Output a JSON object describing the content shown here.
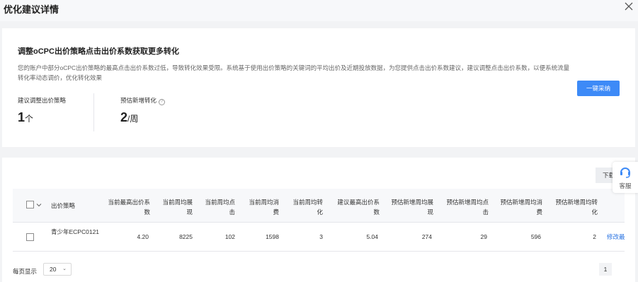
{
  "dialog": {
    "title": "优化建议详情"
  },
  "card": {
    "title": "调整oCPC出价策略点击出价系数获取更多转化",
    "description": "您的账户中部分oCPC出价策略的最高点击出价系数过低，导致转化效果受限。系统基于使用出价策略的关键词的平均出价及近期投放数据，为您提供点击出价系数建议，建议调整点击出价系数，以便系统流量转化率动态调价，优化转化效果",
    "apply_button": "一键采纳",
    "stats": [
      {
        "label": "建议调整出价策略",
        "value": "1",
        "unit": "个"
      },
      {
        "label": "预估新增转化",
        "value": "2",
        "unit": "/周"
      }
    ]
  },
  "table": {
    "download_label": "下载",
    "columns": [
      "出价策略",
      "当前最高出价系数",
      "当前周均展现",
      "当前周均点击",
      "当前周均消费",
      "当前周均转化",
      "建议最高出价系数",
      "预估新增周均展现",
      "预估新增周均点击",
      "预估新增周均消费",
      "预估新增周均转化"
    ],
    "rows": [
      {
        "strategy": "青少年ECPC0121",
        "values": [
          "4.20",
          "8225",
          "102",
          "1598",
          "3",
          "5.04",
          "274",
          "29",
          "596",
          "2"
        ],
        "action": "修改最"
      }
    ]
  },
  "pagination": {
    "label": "每页显示",
    "page_size": "20",
    "current_page": "1"
  },
  "service": {
    "label": "客服"
  },
  "icons": {
    "close": "close-icon",
    "help": "help-icon",
    "chevron": "chevron-down-icon",
    "service": "headset-icon"
  },
  "colors": {
    "primary": "#3d8af7",
    "link": "#2b74e2"
  }
}
